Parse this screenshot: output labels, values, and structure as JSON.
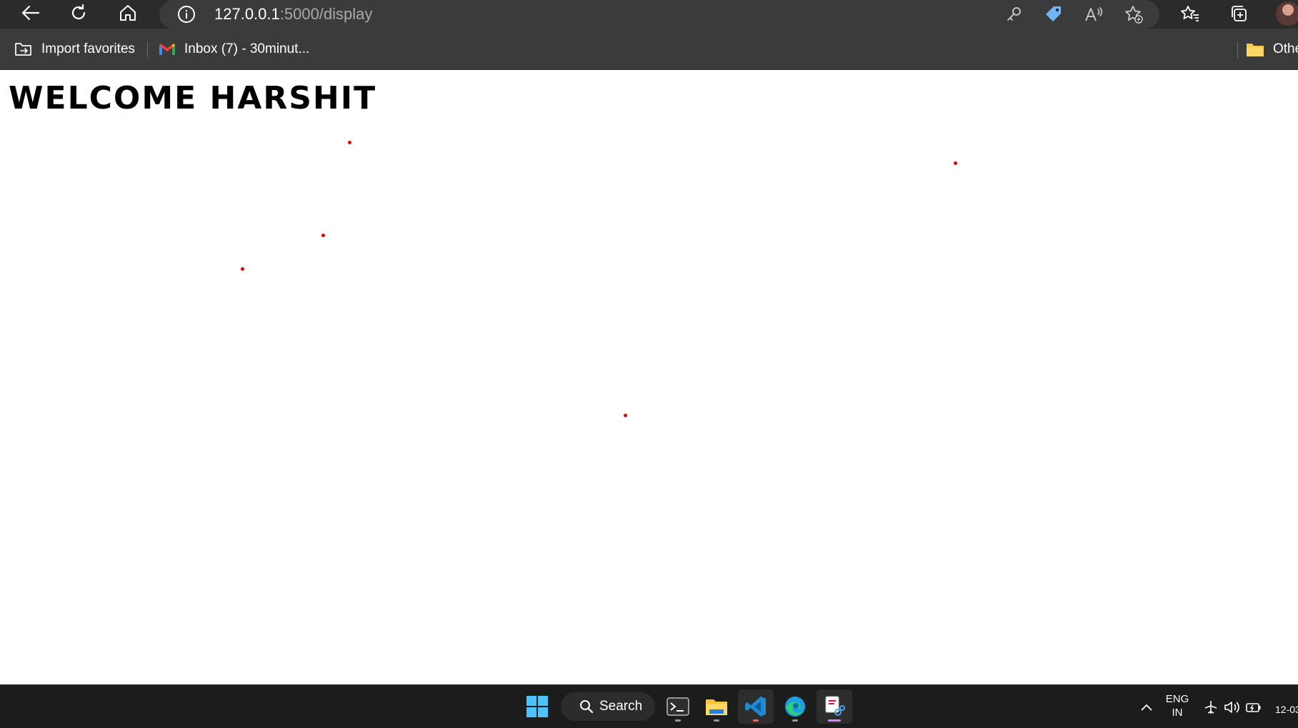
{
  "browser": {
    "url_host": "127.0.0.1",
    "url_rest": ":5000/display",
    "icons": {
      "back": "back-arrow-icon",
      "refresh": "refresh-icon",
      "home": "home-icon",
      "info": "info-icon",
      "key": "key-icon",
      "tag": "tag-icon",
      "read_aloud": "read-aloud-icon",
      "add_favorite": "add-favorite-icon",
      "favorites": "favorites-icon",
      "collections": "collections-icon"
    }
  },
  "favorites_bar": {
    "items": [
      {
        "label": "Import favorites",
        "icon": "import-favorites-icon"
      },
      {
        "label": "Inbox (7) - 30minut...",
        "icon": "gmail-icon"
      }
    ],
    "other_label": "Othe"
  },
  "page": {
    "title": "WELCOME HARSHIT",
    "dot_color": "#e00000"
  },
  "taskbar": {
    "search_label": "Search",
    "apps": [
      "start-icon",
      "terminal-icon",
      "file-explorer-icon",
      "vscode-icon",
      "edge-icon",
      "snipping-tool-icon"
    ],
    "tray_lang_line1": "ENG",
    "tray_lang_line2": "IN",
    "clock": "12-03"
  }
}
